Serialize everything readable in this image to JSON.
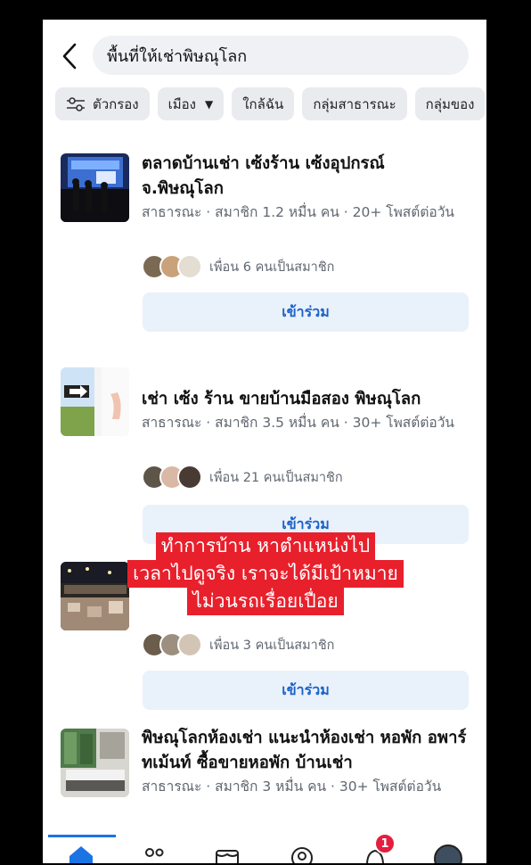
{
  "search": {
    "query": "พื้นที่ให้เช่าพิษณุโลก"
  },
  "filters": [
    {
      "label": "ตัวกรอง",
      "icon": "sliders-icon"
    },
    {
      "label": "เมือง",
      "icon": "caret-down-icon"
    },
    {
      "label": "ใกล้ฉัน"
    },
    {
      "label": "กลุ่มสาธารณะ"
    },
    {
      "label": "กลุ่มของ"
    }
  ],
  "results": [
    {
      "title": "ตลาดบ้านเช่า เซ้งร้าน เซ้งอุปกรณ์ จ.พิษณุโลก",
      "meta": "สาธารณะ · สมาชิก 1.2 หมื่น คน · 20+ โพสต์ต่อวัน",
      "friends": "เพื่อน 6 คนเป็นสมาชิก",
      "join": "เข้าร่วม"
    },
    {
      "title": "เช่า เซ้ง ร้าน ขายบ้านมือสอง พิษณุโลก",
      "meta": "สาธารณะ · สมาชิก 3.5 หมื่น คน · 30+ โพสต์ต่อวัน",
      "friends": "เพื่อน 21 คนเป็นสมาชิก",
      "join": "เข้าร่วม"
    },
    {
      "title": "",
      "meta": "",
      "friends": "เพื่อน 3 คนเป็นสมาชิก",
      "join": "เข้าร่วม"
    },
    {
      "title": "พิษณุโลกห้องเช่า แนะนำห้องเช่า หอพัก อพาร์ทเม้นท์ ซื้อขายหอพัก บ้านเช่า",
      "meta": "สาธารณะ · สมาชิก 3 หมื่น คน · 30+ โพสต์ต่อวัน"
    }
  ],
  "caption": {
    "line1": "ทำการบ้าน หาตำแหน่งไป",
    "line2": "เวลาไปดูจริง เราจะได้มีเป้าหมาย",
    "line3": "ไม่วนรถเรื่อยเปื่อย"
  },
  "nav": {
    "notification_count": "1"
  },
  "colors": {
    "accent": "#1b74e4",
    "join_text": "#1b62c7",
    "join_bg": "#e9f1fb",
    "caption_bg": "#e8202c",
    "badge": "#e41e3f"
  }
}
